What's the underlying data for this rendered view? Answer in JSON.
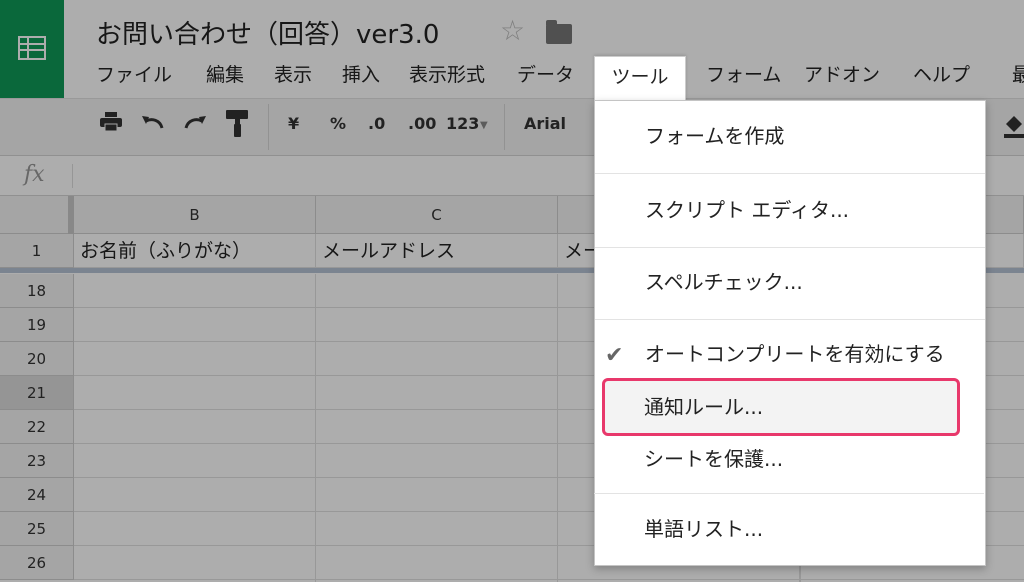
{
  "app": {
    "title": "お問い合わせ（回答）ver3.0"
  },
  "menubar": [
    "ファイル",
    "編集",
    "表示",
    "挿入",
    "表示形式",
    "データ",
    "ツール",
    "フォーム",
    "アドオン",
    "ヘルプ",
    "最"
  ],
  "toolbar": {
    "currency": "¥",
    "percent": "%",
    "dec_decrease": ".0",
    "dec_increase": ".00",
    "format_number": "123",
    "font": "Arial"
  },
  "formula": {
    "fx": "fx"
  },
  "grid": {
    "columns": [
      "B",
      "C"
    ],
    "header_row": {
      "num": "1",
      "cells": [
        "お名前（ふりがな）",
        "メールアドレス",
        "メー"
      ]
    },
    "rows": [
      "18",
      "19",
      "20",
      "21",
      "22",
      "23",
      "24",
      "25",
      "26"
    ]
  },
  "tools_menu": {
    "items": [
      {
        "label": "フォームを作成"
      },
      {
        "label": "スクリプト エディタ..."
      },
      {
        "label": "スペルチェック..."
      },
      {
        "label": "オートコンプリートを有効にする",
        "checked": true
      },
      {
        "label": "通知ルール...",
        "highlighted": true
      },
      {
        "label": "シートを保護..."
      },
      {
        "label": "単語リスト..."
      }
    ]
  },
  "colors": {
    "brand": "#109a58",
    "highlight_border": "#e8386b"
  }
}
